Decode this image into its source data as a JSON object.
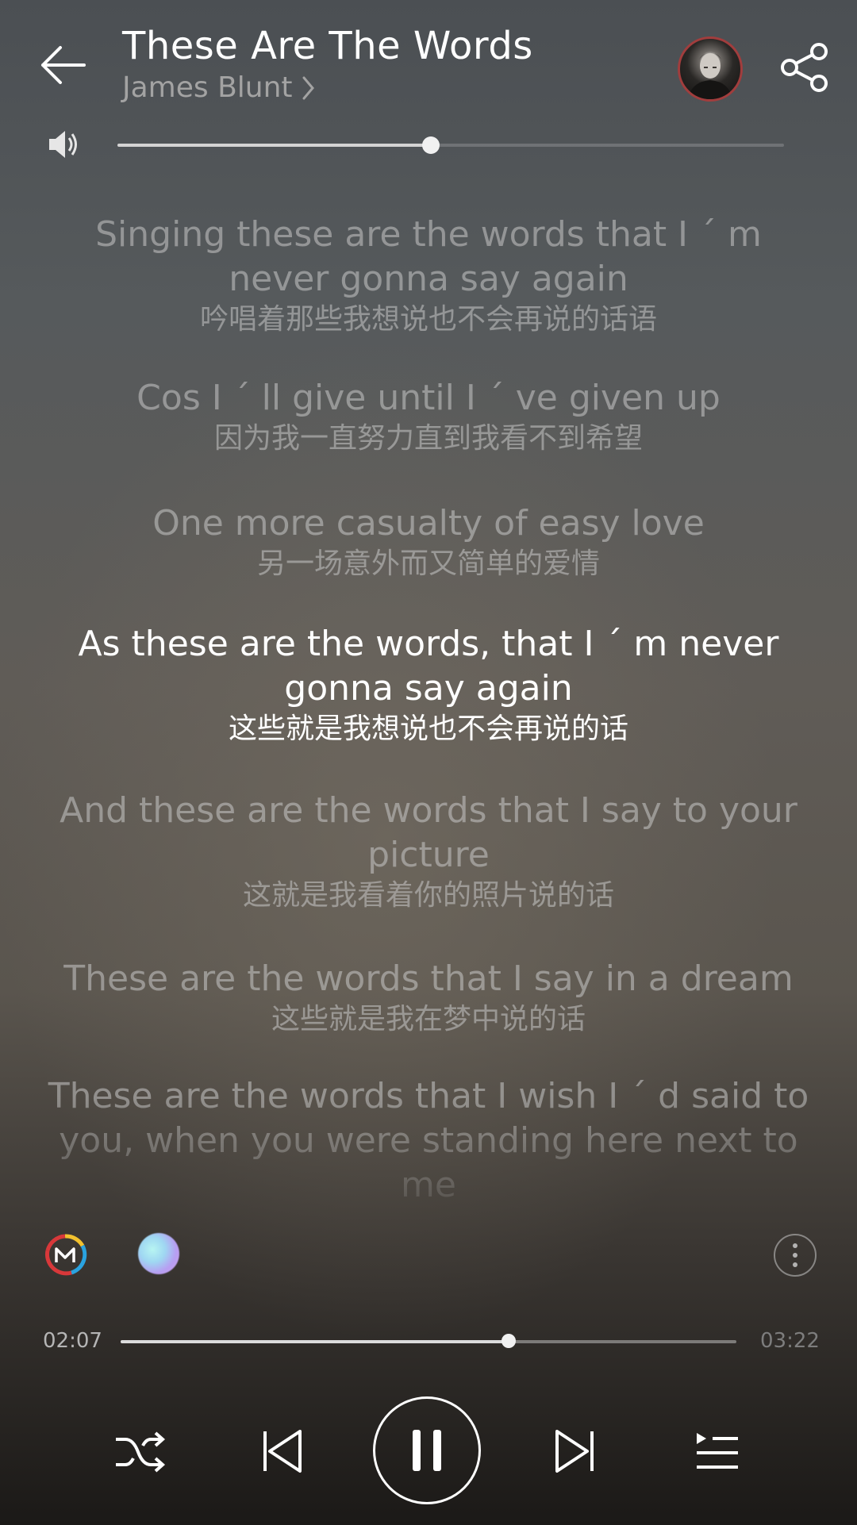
{
  "header": {
    "title": "These Are The Words",
    "artist": "James Blunt",
    "artist_chevron": ">"
  },
  "volume": {
    "level": 0.47
  },
  "lyrics": [
    {
      "en": "Singing these are the words that I ´ m never gonna say again",
      "zh": "吟唱着那些我想说也不会再说的话语",
      "active": false
    },
    {
      "en": "Cos I ´ ll give until I ´ ve given up",
      "zh": "因为我一直努力直到我看不到希望",
      "active": false
    },
    {
      "en": "One more casualty of easy love",
      "zh": "另一场意外而又简单的爱情",
      "active": false
    },
    {
      "en": "As these are the words, that I ´ m never gonna say again",
      "zh": "这些就是我想说也不会再说的话",
      "active": true
    },
    {
      "en": "And these are the words that I say to your picture",
      "zh": "这就是我看着你的照片说的话",
      "active": false
    },
    {
      "en": "These are the words that I say in a dream",
      "zh": "这些就是我在梦中说的话",
      "active": false
    },
    {
      "en": "These are the words that I wish I ´ d said to you, when you were standing here next to me",
      "zh": "",
      "active": false
    }
  ],
  "player": {
    "current_time": "02:07",
    "total_time": "03:22",
    "progress": 0.63
  },
  "icons": {
    "back": "arrow-left-icon",
    "share": "share-icon",
    "volume": "speaker-icon",
    "more": "more-vertical-icon",
    "shuffle": "shuffle-icon",
    "prev": "skip-previous-icon",
    "pause": "pause-icon",
    "next": "skip-next-icon",
    "playlist": "playlist-icon"
  },
  "colors": {
    "text_primary": "#ffffff",
    "text_dim": "#a3a3a3",
    "avatar_ring": "#a13d3d"
  }
}
